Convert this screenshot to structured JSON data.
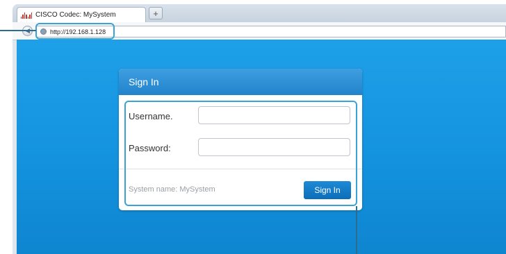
{
  "browser": {
    "tab_title": "CISCO Codec: MySystem",
    "new_tab_label": "+",
    "back_icon": "arrow-left-icon",
    "url": "http://192.168.1.128"
  },
  "signin": {
    "header": "Sign In",
    "username_label": "Username.",
    "username_value": "",
    "password_label": "Password:",
    "password_value": "",
    "system_name": "System name: MySystem",
    "button_label": "Sign In"
  },
  "colors": {
    "background_blue": "#1a9be6",
    "header_blue": "#2f8fd8",
    "button_blue": "#1479c6",
    "callout": "#3aa2d6"
  }
}
